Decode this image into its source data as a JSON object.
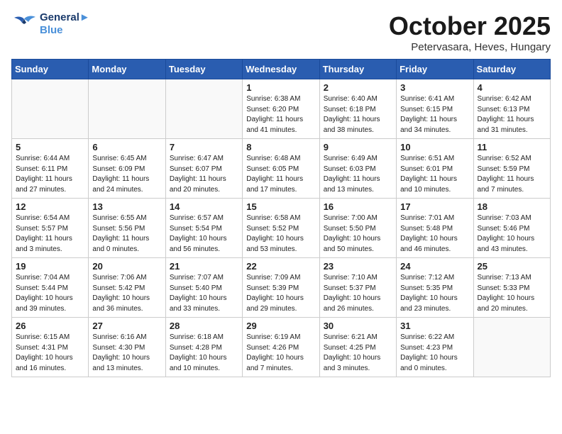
{
  "header": {
    "logo_line1": "General",
    "logo_line2": "Blue",
    "month": "October 2025",
    "location": "Petervasara, Heves, Hungary"
  },
  "weekdays": [
    "Sunday",
    "Monday",
    "Tuesday",
    "Wednesday",
    "Thursday",
    "Friday",
    "Saturday"
  ],
  "weeks": [
    [
      {
        "day": "",
        "info": ""
      },
      {
        "day": "",
        "info": ""
      },
      {
        "day": "",
        "info": ""
      },
      {
        "day": "1",
        "info": "Sunrise: 6:38 AM\nSunset: 6:20 PM\nDaylight: 11 hours\nand 41 minutes."
      },
      {
        "day": "2",
        "info": "Sunrise: 6:40 AM\nSunset: 6:18 PM\nDaylight: 11 hours\nand 38 minutes."
      },
      {
        "day": "3",
        "info": "Sunrise: 6:41 AM\nSunset: 6:15 PM\nDaylight: 11 hours\nand 34 minutes."
      },
      {
        "day": "4",
        "info": "Sunrise: 6:42 AM\nSunset: 6:13 PM\nDaylight: 11 hours\nand 31 minutes."
      }
    ],
    [
      {
        "day": "5",
        "info": "Sunrise: 6:44 AM\nSunset: 6:11 PM\nDaylight: 11 hours\nand 27 minutes."
      },
      {
        "day": "6",
        "info": "Sunrise: 6:45 AM\nSunset: 6:09 PM\nDaylight: 11 hours\nand 24 minutes."
      },
      {
        "day": "7",
        "info": "Sunrise: 6:47 AM\nSunset: 6:07 PM\nDaylight: 11 hours\nand 20 minutes."
      },
      {
        "day": "8",
        "info": "Sunrise: 6:48 AM\nSunset: 6:05 PM\nDaylight: 11 hours\nand 17 minutes."
      },
      {
        "day": "9",
        "info": "Sunrise: 6:49 AM\nSunset: 6:03 PM\nDaylight: 11 hours\nand 13 minutes."
      },
      {
        "day": "10",
        "info": "Sunrise: 6:51 AM\nSunset: 6:01 PM\nDaylight: 11 hours\nand 10 minutes."
      },
      {
        "day": "11",
        "info": "Sunrise: 6:52 AM\nSunset: 5:59 PM\nDaylight: 11 hours\nand 7 minutes."
      }
    ],
    [
      {
        "day": "12",
        "info": "Sunrise: 6:54 AM\nSunset: 5:57 PM\nDaylight: 11 hours\nand 3 minutes."
      },
      {
        "day": "13",
        "info": "Sunrise: 6:55 AM\nSunset: 5:56 PM\nDaylight: 11 hours\nand 0 minutes."
      },
      {
        "day": "14",
        "info": "Sunrise: 6:57 AM\nSunset: 5:54 PM\nDaylight: 10 hours\nand 56 minutes."
      },
      {
        "day": "15",
        "info": "Sunrise: 6:58 AM\nSunset: 5:52 PM\nDaylight: 10 hours\nand 53 minutes."
      },
      {
        "day": "16",
        "info": "Sunrise: 7:00 AM\nSunset: 5:50 PM\nDaylight: 10 hours\nand 50 minutes."
      },
      {
        "day": "17",
        "info": "Sunrise: 7:01 AM\nSunset: 5:48 PM\nDaylight: 10 hours\nand 46 minutes."
      },
      {
        "day": "18",
        "info": "Sunrise: 7:03 AM\nSunset: 5:46 PM\nDaylight: 10 hours\nand 43 minutes."
      }
    ],
    [
      {
        "day": "19",
        "info": "Sunrise: 7:04 AM\nSunset: 5:44 PM\nDaylight: 10 hours\nand 39 minutes."
      },
      {
        "day": "20",
        "info": "Sunrise: 7:06 AM\nSunset: 5:42 PM\nDaylight: 10 hours\nand 36 minutes."
      },
      {
        "day": "21",
        "info": "Sunrise: 7:07 AM\nSunset: 5:40 PM\nDaylight: 10 hours\nand 33 minutes."
      },
      {
        "day": "22",
        "info": "Sunrise: 7:09 AM\nSunset: 5:39 PM\nDaylight: 10 hours\nand 29 minutes."
      },
      {
        "day": "23",
        "info": "Sunrise: 7:10 AM\nSunset: 5:37 PM\nDaylight: 10 hours\nand 26 minutes."
      },
      {
        "day": "24",
        "info": "Sunrise: 7:12 AM\nSunset: 5:35 PM\nDaylight: 10 hours\nand 23 minutes."
      },
      {
        "day": "25",
        "info": "Sunrise: 7:13 AM\nSunset: 5:33 PM\nDaylight: 10 hours\nand 20 minutes."
      }
    ],
    [
      {
        "day": "26",
        "info": "Sunrise: 6:15 AM\nSunset: 4:31 PM\nDaylight: 10 hours\nand 16 minutes."
      },
      {
        "day": "27",
        "info": "Sunrise: 6:16 AM\nSunset: 4:30 PM\nDaylight: 10 hours\nand 13 minutes."
      },
      {
        "day": "28",
        "info": "Sunrise: 6:18 AM\nSunset: 4:28 PM\nDaylight: 10 hours\nand 10 minutes."
      },
      {
        "day": "29",
        "info": "Sunrise: 6:19 AM\nSunset: 4:26 PM\nDaylight: 10 hours\nand 7 minutes."
      },
      {
        "day": "30",
        "info": "Sunrise: 6:21 AM\nSunset: 4:25 PM\nDaylight: 10 hours\nand 3 minutes."
      },
      {
        "day": "31",
        "info": "Sunrise: 6:22 AM\nSunset: 4:23 PM\nDaylight: 10 hours\nand 0 minutes."
      },
      {
        "day": "",
        "info": ""
      }
    ]
  ]
}
